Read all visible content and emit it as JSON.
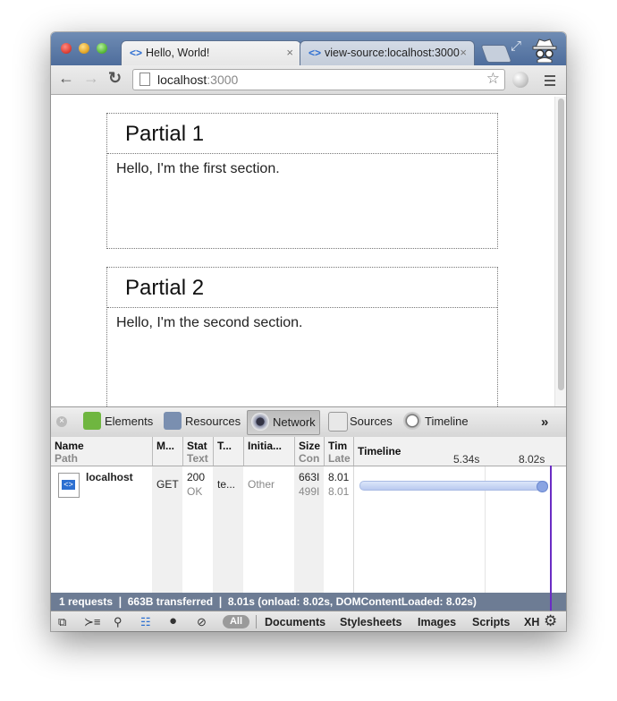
{
  "tabs": [
    {
      "title": "Hello, World!",
      "close": "×"
    },
    {
      "title": "view-source:localhost:3000",
      "close": "×"
    }
  ],
  "toolbar": {
    "back": "←",
    "forward": "→",
    "reload": "↻",
    "url_host": "localhost",
    "url_port": ":3000",
    "star": "☆"
  },
  "content": {
    "sections": [
      {
        "title": "Partial 1",
        "text": "Hello, I'm the first section."
      },
      {
        "title": "Partial 2",
        "text": "Hello, I'm the second section."
      }
    ]
  },
  "devtools": {
    "panels": [
      "Elements",
      "Resources",
      "Network",
      "Sources",
      "Timeline"
    ],
    "selected_panel": "Network",
    "more": "»",
    "columns": [
      {
        "h1": "Name",
        "h2": "Path"
      },
      {
        "h1": "M...",
        "h2": ""
      },
      {
        "h1": "Stat",
        "h2": "Text"
      },
      {
        "h1": "T...",
        "h2": ""
      },
      {
        "h1": "Initia...",
        "h2": ""
      },
      {
        "h1": "Size",
        "h2": "Con"
      },
      {
        "h1": "Tim",
        "h2": "Late"
      },
      {
        "h1": "Timeline",
        "h2": ""
      }
    ],
    "timeline_ticks": [
      "5.34s",
      "8.02s"
    ],
    "row": {
      "name": "localhost",
      "method": "GET",
      "status": "200",
      "status_text": "OK",
      "type": "te...",
      "initiator": "Other",
      "size": "663I",
      "content": "499I",
      "time": "8.01",
      "latency": "8.01"
    },
    "summary": "1 requests  ❘  663B transferred  ❘  8.01s (onload: 8.02s, DOMContentLoaded: 8.02s)",
    "filters": [
      "All",
      "Documents",
      "Stylesheets",
      "Images",
      "Scripts",
      "XH"
    ]
  }
}
